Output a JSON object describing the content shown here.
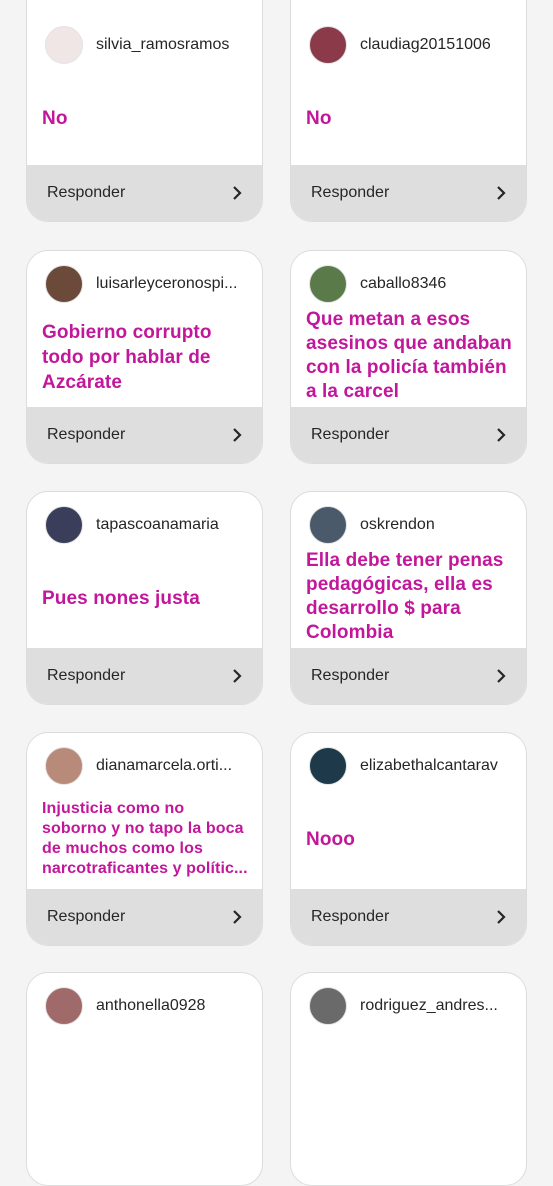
{
  "reply_label": "Responder",
  "cards": [
    {
      "username": "silvia_ramosramos",
      "message": "No",
      "avatar_color": "#f1e6e6"
    },
    {
      "username": "claudiag20151006",
      "message": "No",
      "avatar_color": "#8b3a4a"
    },
    {
      "username": "luisarleyceronospi...",
      "message": "Gobierno corrupto todo por hablar de Azcárate",
      "avatar_color": "#6b4a3a"
    },
    {
      "username": "caballo8346",
      "message": "Que metan a esos asesinos que andaban con la policía también a la carcel",
      "avatar_color": "#5a7a4a"
    },
    {
      "username": "tapascoanamaria",
      "message": "Pues nones justa",
      "avatar_color": "#3a3e5a"
    },
    {
      "username": "oskrendon",
      "message": "Ella debe tener penas pedagógicas, ella es desarrollo $ para Colombia",
      "avatar_color": "#4a5a6a"
    },
    {
      "username": "dianamarcela.orti...",
      "message": "Injusticia como no soborno y no tapo la boca de muchos como los narcotraficantes y polític...",
      "avatar_color": "#b88a7a"
    },
    {
      "username": "elizabethalcantarav",
      "message": "Nooo",
      "avatar_color": "#1e3a4a"
    },
    {
      "username": "anthonella0928",
      "message": "",
      "avatar_color": "#a06a6a"
    },
    {
      "username": "rodriguez_andres...",
      "message": "",
      "avatar_color": "#6a6a6a"
    }
  ],
  "colors": {
    "message": "#c2179b",
    "reply_bar": "#dedede"
  },
  "icons": {
    "chevron": "chevron-right-icon"
  }
}
